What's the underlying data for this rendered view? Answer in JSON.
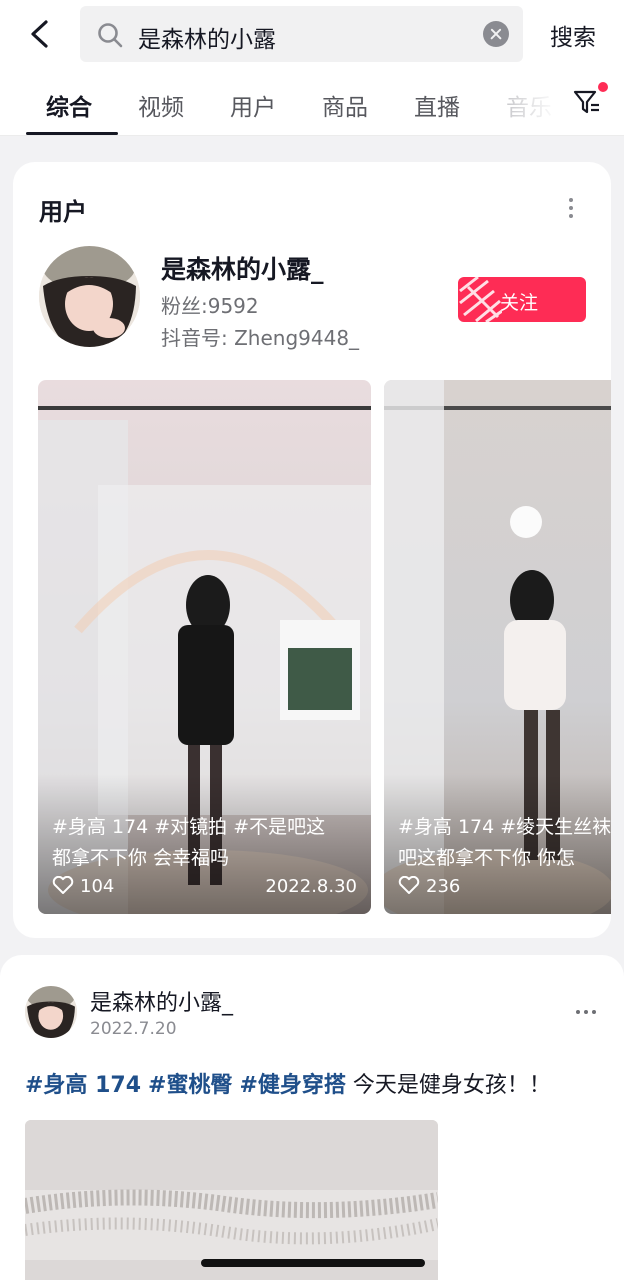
{
  "search": {
    "query": "是森林的小露",
    "button_label": "搜索"
  },
  "tabs": [
    {
      "label": "综合",
      "active": true
    },
    {
      "label": "视频"
    },
    {
      "label": "用户"
    },
    {
      "label": "商品"
    },
    {
      "label": "直播"
    },
    {
      "label": "音乐"
    }
  ],
  "user_section": {
    "title": "用户",
    "name": "是森林的小露_",
    "fans": "粉丝:9592",
    "douyin_id": "抖音号: Zheng9448_",
    "follow_label": "关注",
    "videos": [
      {
        "caption_line1": "#身高 174 #对镜拍 #不是吧这",
        "caption_line2": "都拿不下你 会幸福吗",
        "likes": "104",
        "date": "2022.8.30"
      },
      {
        "caption_line1": "#身高 174 #绫天生丝袜",
        "caption_line2": "吧这都拿不下你  你怎",
        "likes": "236"
      }
    ]
  },
  "post": {
    "author": "是森林的小露_",
    "date": "2022.7.20",
    "tags": [
      "#身高 174",
      "#蜜桃臀",
      "#健身穿搭"
    ],
    "text": "今天是健身女孩！！"
  },
  "colors": {
    "accent": "#fe2c55",
    "hashtag": "#1f4f8a",
    "text": "#161823"
  }
}
